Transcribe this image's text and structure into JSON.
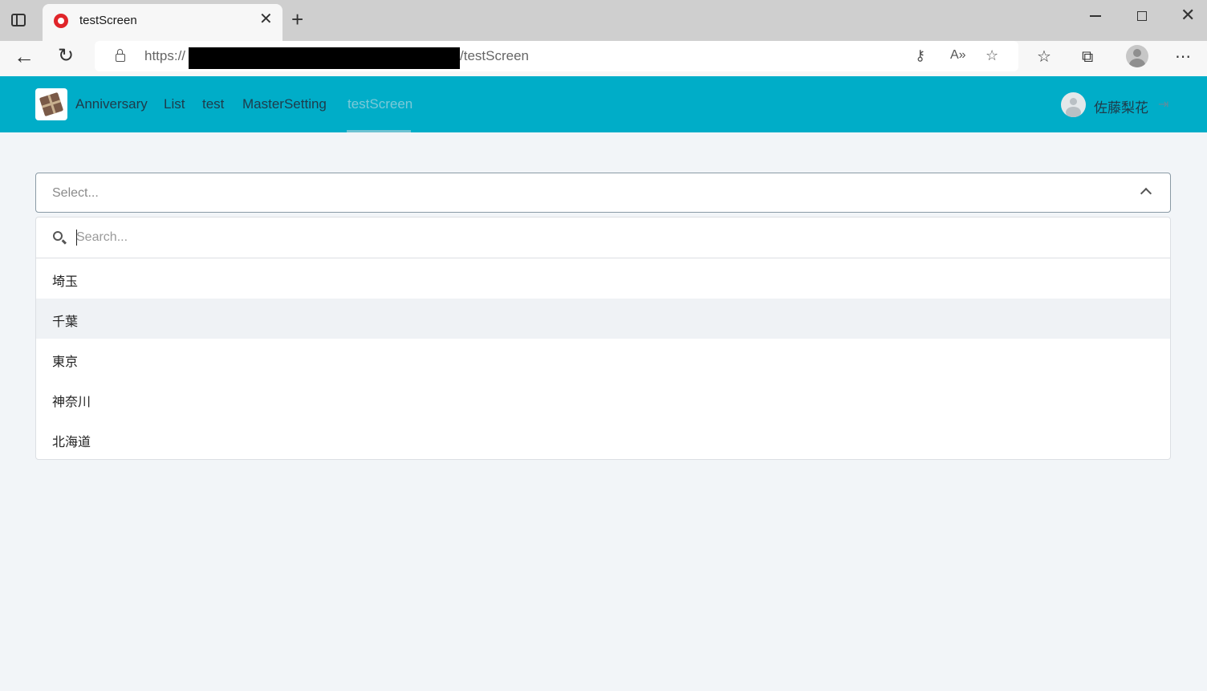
{
  "browser": {
    "tab_title": "testScreen",
    "url_prefix": "https://",
    "url_suffix": "/testScreen"
  },
  "navbar": {
    "links": [
      {
        "label": "Anniversary"
      },
      {
        "label": "List"
      },
      {
        "label": "test"
      },
      {
        "label": "MasterSetting"
      },
      {
        "label": "testScreen",
        "active": true
      }
    ],
    "user_name": "佐藤梨花",
    "accent_color": "#00adc8"
  },
  "select": {
    "placeholder": "Select...",
    "search_placeholder": "Search...",
    "options": [
      "埼玉",
      "千葉",
      "東京",
      "神奈川",
      "北海道"
    ],
    "hovered_option": "千葉"
  }
}
